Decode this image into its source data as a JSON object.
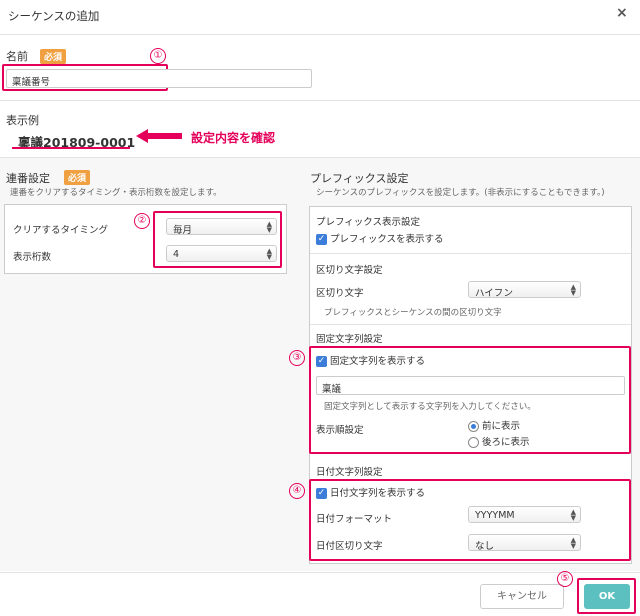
{
  "dialog": {
    "title": "シーケンスの追加",
    "close": "×"
  },
  "required_badge": "必須",
  "name": {
    "label": "名前",
    "value": "稟議番号",
    "marker": "①"
  },
  "example": {
    "label": "表示例",
    "value": "稟議201809-0001",
    "annotation": "設定内容を確認"
  },
  "serial": {
    "title": "連番設定",
    "desc": "連番をクリアするタイミング・表示桁数を設定します。",
    "marker": "②",
    "clear_label": "クリアするタイミング",
    "clear_value": "毎月",
    "digits_label": "表示桁数",
    "digits_value": "4"
  },
  "prefix": {
    "title": "プレフィックス設定",
    "desc": "シーケンスのプレフィックスを設定します。(非表示にすることもできます。)",
    "display_title": "プレフィックス表示設定",
    "display_checkbox": "プレフィックスを表示する",
    "sep_title": "区切り文字設定",
    "sep_label": "区切り文字",
    "sep_value": "ハイフン",
    "sep_hint": "プレフィックスとシーケンスの間の区切り文字",
    "fixed_title": "固定文字列設定",
    "fixed_marker": "③",
    "fixed_checkbox": "固定文字列を表示する",
    "fixed_value": "稟議",
    "fixed_hint": "固定文字列として表示する文字列を入力してください。",
    "order_label": "表示順設定",
    "order_before": "前に表示",
    "order_after": "後ろに表示",
    "date_title": "日付文字列設定",
    "date_marker": "④",
    "date_checkbox": "日付文字列を表示する",
    "date_format_label": "日付フォーマット",
    "date_format_value": "YYYYMM",
    "date_sep_label": "日付区切り文字",
    "date_sep_value": "なし"
  },
  "footer": {
    "cancel": "キャンセル",
    "ok": "OK",
    "marker": "⑤"
  },
  "colors": {
    "accent": "#e4005a",
    "ok": "#5cc0c0",
    "badge": "#f0a040",
    "checkbox": "#3b7dd8"
  },
  "icons": {
    "close": "close-icon",
    "arrow": "left-arrow-icon",
    "checkbox": "checkbox-checked-icon"
  }
}
